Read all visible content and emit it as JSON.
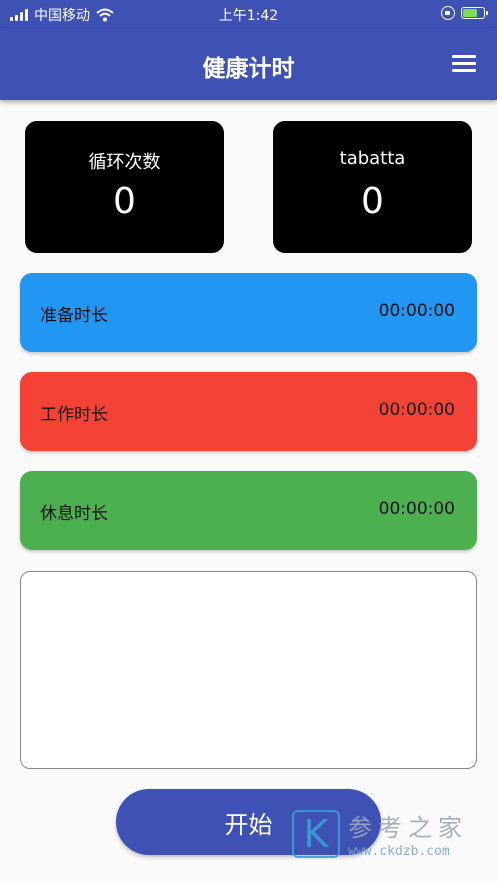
{
  "status_bar": {
    "carrier": "中国移动",
    "time": "上午1:42",
    "icons": [
      "signal-icon",
      "wifi-icon",
      "rotation-lock-icon",
      "battery-charging-icon"
    ],
    "battery_color": "#7ddc4f"
  },
  "app_bar": {
    "title": "健康计时",
    "menu_icon": "hamburger-menu-icon",
    "background": "#3f51b5"
  },
  "counters": [
    {
      "label": "循环次数",
      "value": "0"
    },
    {
      "label": "tabatta",
      "value": "0"
    }
  ],
  "timers": [
    {
      "label": "准备时长",
      "value": "00:00:00",
      "color": "#2196f3"
    },
    {
      "label": "工作时长",
      "value": "00:00:00",
      "color": "#f44336"
    },
    {
      "label": "休息时长",
      "value": "00:00:00",
      "color": "#4caf50"
    }
  ],
  "notes": {
    "value": "",
    "placeholder": ""
  },
  "start_button": {
    "label": "开始"
  },
  "watermark": {
    "logo_letter": "K",
    "name": "参考之家",
    "url": "www.ckdzb.com"
  }
}
